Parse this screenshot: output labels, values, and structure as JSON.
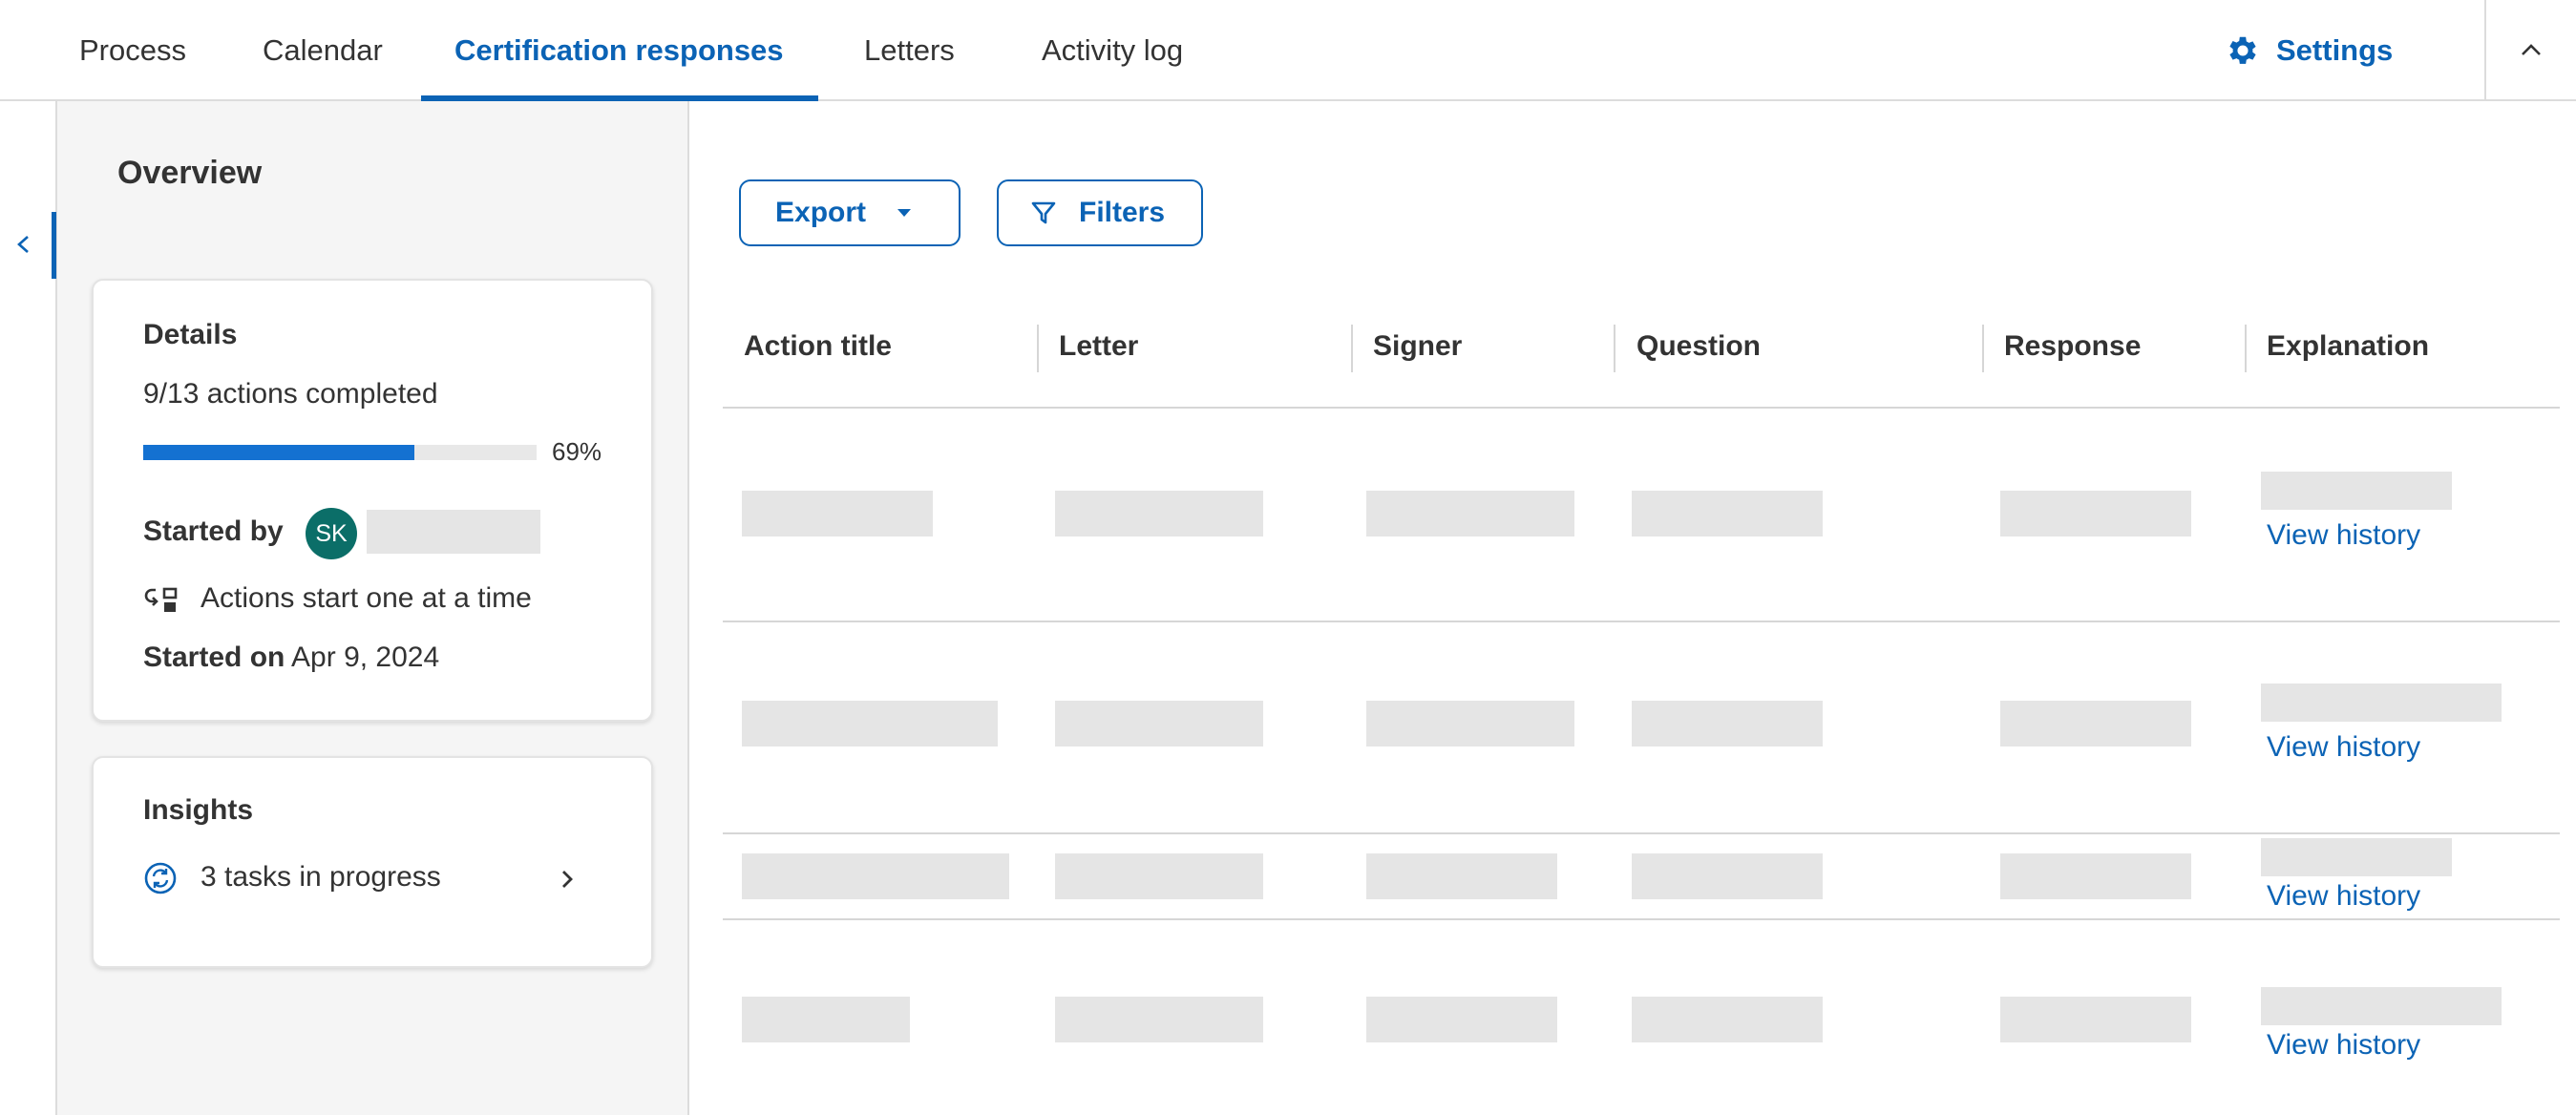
{
  "nav": {
    "tabs": [
      {
        "label": "Process"
      },
      {
        "label": "Calendar"
      },
      {
        "label": "Certification responses",
        "active": true
      },
      {
        "label": "Letters"
      },
      {
        "label": "Activity log"
      }
    ],
    "settings_label": "Settings",
    "collapse_icon": "chevron-up-icon"
  },
  "rail": {
    "toggle_icon": "chevron-left-icon"
  },
  "overview": {
    "title": "Overview",
    "details": {
      "heading": "Details",
      "summary": "9/13 actions completed",
      "progress_percent": 69,
      "progress_label": "69%",
      "started_by_label": "Started by",
      "avatar_initials": "SK",
      "mode_icon": "sequential-actions-icon",
      "mode_text": "Actions start one at a time",
      "started_on_label": "Started on",
      "started_on_value": "Apr 9, 2024"
    },
    "insights": {
      "heading": "Insights",
      "icon": "sync-icon",
      "text": "3 tasks in progress",
      "chevron": "chevron-right-icon"
    }
  },
  "toolbar": {
    "export_label": "Export",
    "filters_label": "Filters"
  },
  "table": {
    "columns": [
      "Action title",
      "Letter",
      "Signer",
      "Question",
      "Response",
      "Explanation"
    ],
    "row_link_label": "View history",
    "row_count": 4
  },
  "colors": {
    "accent": "#0b63b5",
    "progress_fill": "#1471d1",
    "avatar_bg": "#0b6e68",
    "skeleton": "#e5e5e5"
  }
}
